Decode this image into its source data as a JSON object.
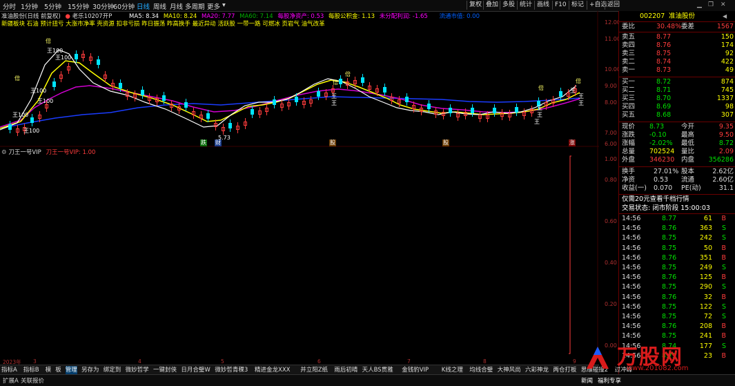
{
  "toolbar": {
    "periods": [
      "分时",
      "1分钟",
      "5分钟",
      "15分钟",
      "30分钟",
      "60分钟",
      "日线",
      "周线",
      "月线",
      "多周期",
      "更多"
    ],
    "active_period": "日线",
    "buttons": [
      "复权",
      "叠加",
      "多股",
      "统计",
      "画线",
      "F10",
      "标记",
      "+自选",
      "返回"
    ]
  },
  "chart_header": {
    "stock": "准油股份(日线 前复权)",
    "indicator": "老乐10207开P",
    "ma5": "MA5: 8.34",
    "ma10": "MA10: 8.24",
    "ma20": "MA20: 7.77",
    "ma60": "MA60: 7.14",
    "info1": "每股净资产: 0.53",
    "info2": "每股公积金: 1.13",
    "info3": "未分配利润: -1.65",
    "info4": "流通市值: 0.00"
  },
  "concepts": "新疆板块 石油 预计扭亏 大涨市净率 壳资源 扣非亏损 昨日振荡 昨高换手 最近异动 活跃股 一带一路 可燃冰 页岩气 油气改革",
  "chart_marks": [
    "王100",
    "王100",
    "王100",
    "王100",
    "王100",
    "王100",
    "王",
    "王",
    "王",
    "王",
    "王",
    "王",
    "王",
    "王",
    "倍",
    "倍",
    "倍",
    "倍",
    "倍",
    "倍",
    "5.73"
  ],
  "chart_tags": {
    "die": "跌",
    "cai": "财",
    "sub1": "股",
    "sub2": "股",
    "shang": "涨"
  },
  "price_axis": [
    "12.00",
    "11.00",
    "10.00",
    "9.00",
    "8.00",
    "7.00",
    "6.00"
  ],
  "price_axis_highlight": "8.73",
  "lower_header": {
    "name": "刀王一号VIP",
    "sub": "刀王一号VIP: 1.00"
  },
  "lower_axis": [
    "1.00",
    "0.80",
    "0.60",
    "0.40",
    "0.20",
    "0.00"
  ],
  "year_axis": {
    "year": "2023年",
    "months": [
      "3",
      "4",
      "5",
      "6",
      "7",
      "8",
      "9"
    ]
  },
  "quote": {
    "code": "002207",
    "name": "准油股份",
    "webi_label": "委比",
    "webi_value": "30.48%",
    "weicha_label": "委差",
    "weicha_value": "1567",
    "asks": [
      {
        "label": "卖五",
        "price": "8.77",
        "vol": "150"
      },
      {
        "label": "卖四",
        "price": "8.76",
        "vol": "174"
      },
      {
        "label": "卖三",
        "price": "8.75",
        "vol": "92"
      },
      {
        "label": "卖二",
        "price": "8.74",
        "vol": "422"
      },
      {
        "label": "卖一",
        "price": "8.73",
        "vol": "49"
      }
    ],
    "bids": [
      {
        "label": "买一",
        "price": "8.72",
        "vol": "874"
      },
      {
        "label": "买二",
        "price": "8.71",
        "vol": "745"
      },
      {
        "label": "买三",
        "price": "8.70",
        "vol": "1337"
      },
      {
        "label": "买四",
        "price": "8.69",
        "vol": "98"
      },
      {
        "label": "买五",
        "price": "8.68",
        "vol": "307"
      }
    ],
    "stats": [
      {
        "l1": "现价",
        "v1": "8.73",
        "l2": "今开",
        "v2": "9.35"
      },
      {
        "l1": "涨跌",
        "v1": "-0.10",
        "l2": "最高",
        "v2": "9.50"
      },
      {
        "l1": "涨幅",
        "v1": "-2.02%",
        "l2": "最低",
        "v2": "8.72"
      },
      {
        "l1": "总量",
        "v1": "702524",
        "l2": "量比",
        "v2": "2.09"
      },
      {
        "l1": "外盘",
        "v1": "346230",
        "l2": "内盘",
        "v2": "356286"
      }
    ],
    "stats2": [
      {
        "l1": "换手",
        "v1": "27.01%",
        "l2": "股本",
        "v2": "2.62亿"
      },
      {
        "l1": "净资",
        "v1": "0.53",
        "l2": "流通",
        "v2": "2.60亿"
      },
      {
        "l1": "收益(一)",
        "v1": "0.070",
        "l2": "PE(动)",
        "v2": "31.1"
      }
    ],
    "notice": "仅需20元查看千档行情",
    "trade_status": "交易状态: 闭市阶段 15:00:03",
    "ticks": [
      {
        "t": "14:56",
        "p": "8.77",
        "v": "61",
        "d": "B"
      },
      {
        "t": "14:56",
        "p": "8.76",
        "v": "363",
        "d": "S"
      },
      {
        "t": "14:56",
        "p": "8.75",
        "v": "242",
        "d": "S"
      },
      {
        "t": "14:56",
        "p": "8.75",
        "v": "50",
        "d": "B"
      },
      {
        "t": "14:56",
        "p": "8.76",
        "v": "351",
        "d": "B"
      },
      {
        "t": "14:56",
        "p": "8.75",
        "v": "249",
        "d": "S"
      },
      {
        "t": "14:56",
        "p": "8.76",
        "v": "125",
        "d": "B"
      },
      {
        "t": "14:56",
        "p": "8.75",
        "v": "290",
        "d": "S"
      },
      {
        "t": "14:56",
        "p": "8.76",
        "v": "32",
        "d": "B"
      },
      {
        "t": "14:56",
        "p": "8.75",
        "v": "122",
        "d": "S"
      },
      {
        "t": "14:56",
        "p": "8.75",
        "v": "72",
        "d": "S"
      },
      {
        "t": "14:56",
        "p": "8.76",
        "v": "208",
        "d": "B"
      },
      {
        "t": "14:56",
        "p": "8.75",
        "v": "241",
        "d": "B"
      },
      {
        "t": "14:56",
        "p": "8.74",
        "v": "177",
        "d": "S"
      },
      {
        "t": "14:56",
        "p": "8.75",
        "v": "23",
        "d": "B"
      }
    ]
  },
  "bottom_tabs": [
    "指标A",
    "指标B",
    "模",
    "板",
    "管理",
    "另存为",
    "绑定到",
    "微妙哲学",
    "一键封侠",
    "日月合璧W",
    "微妙哲青稞3",
    "精进金龙XXX",
    "并立阳Z纸",
    "雨后初晴",
    "天人BS贯雅",
    "金钱豹VIP",
    "K线之理",
    "均线合璧",
    "大神风尚",
    "六彩神龙",
    "两仓打板",
    "思维碰撞2",
    "过冲峰"
  ],
  "active_tab": "管理",
  "status": {
    "left1": "扩展A",
    "left2": "关联报价",
    "right1": "新闻",
    "right2": "福利专享"
  },
  "watermark": {
    "text": "万股网",
    "url": "www.201082.com"
  },
  "colors": {
    "up": "#ff3c3c",
    "down": "#00e4ff",
    "ma5": "#ffffff",
    "ma10": "#ffff00",
    "ma20": "#ff00ff",
    "ma60": "#00b000",
    "bg": "#000000",
    "grid": "#6a0000"
  }
}
